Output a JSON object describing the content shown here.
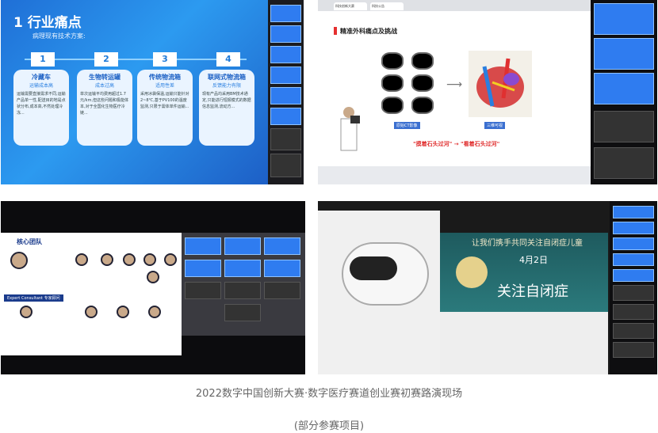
{
  "panels": {
    "p1": {
      "title": "1 行业痛点",
      "subtitle": "病理现有技术方案:",
      "cards": [
        {
          "num": "1",
          "heading": "冷藏车",
          "sub": "运输成本高",
          "body": "运输需要直接需求不同,运输产品单一性,配送目的地是点状分布,成本高,不然处理冷冻..."
        },
        {
          "num": "2",
          "heading": "生物转运罐",
          "sub": "成本过高",
          "body": "单次运输平均费用超过1.7元/km,但这些问题和极能体本,对于全国化生物医疗冷链..."
        },
        {
          "num": "3",
          "heading": "传统物流箱",
          "sub": "适用性差",
          "body": "采用冰袋保温,运输只能针对2~8℃,基于PV100的温度监测,只限于需体单件运输..."
        },
        {
          "num": "4",
          "heading": "联网式物流箱",
          "sub": "反馈能力有限",
          "body": "现有产品均采用BM技术通定,只能进行短报模式的数据信息监测,流动方..."
        }
      ]
    },
    "p2": {
      "tab1": "科技创新大赛",
      "tab2": "科技公告",
      "slide_title": "精准外科痛点及挑战",
      "label_left": "原始CT影像",
      "label_right": "三维可视",
      "red_line": "\"摸着石头过河\" → \"看着石头过河\""
    },
    "p3": {
      "slide_title": "核心团队",
      "expert": "Expert Consultant 专家顾问"
    },
    "p4": {
      "line1": "让我们携手共同关注自闭症儿童",
      "line2": "4月2日",
      "line3": "关注自闭症"
    }
  },
  "caption": {
    "line1": "2022数字中国创新大赛·数字医疗赛道创业赛初赛路演现场",
    "line2": "(部分参赛项目)"
  }
}
